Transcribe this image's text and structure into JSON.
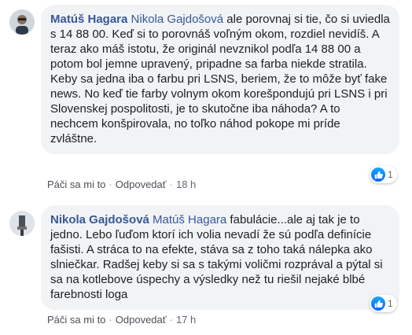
{
  "comments": [
    {
      "author": "Matúš Hagara",
      "mention": "Nikola Gajdošová",
      "first_line_rest": " ale porovnaj si tie, čo si uviedla s 14 88 00. Keď si to porovnáš voľným okom, rozdiel nevidíš. A teraz ako máš istotu, že originál nevznikol podľa 14 88 00 a potom bol jemne upravený, pripadne sa farba niekde stratila.",
      "paragraph2": "Keby sa jedna iba o farbu pri LSNS, beriem, že to môže byť fake news. No keď tie farby volnym okom korešpondujú pri LSNS i pri Slovenskej pospolitosti, je to skutočne iba náhoda? A to nechcem konšpirovala, no toľko náhod pokope mi príde zvláštne.",
      "reaction_count": "1",
      "like_label": "Páči sa mi to",
      "reply_label": "Odpovedať",
      "time": "18 h"
    },
    {
      "author": "Nikola Gajdošová",
      "mention": "Matúš Hagara",
      "first_line_rest": " fabulácie...ale aj tak je to jedno. Lebo ľuďom ktorí ich volia nevadí že sú podľa definície fašisti. A stráca to na efekte, stáva sa z toho taká nálepka ako slniečkar. Radšej keby si sa s takými voličmi rozprával a pýtal si sa na kotlebove úspechy a výsledky než tu riešil nejaké blbé farebnosti loga",
      "reaction_count": "1",
      "like_label": "Páči sa mi to",
      "reply_label": "Odpovedať",
      "time": "17 h"
    }
  ],
  "separator": "·",
  "colors": {
    "link": "#365899",
    "bubble": "#f2f3f5",
    "like": "#0866ff"
  }
}
